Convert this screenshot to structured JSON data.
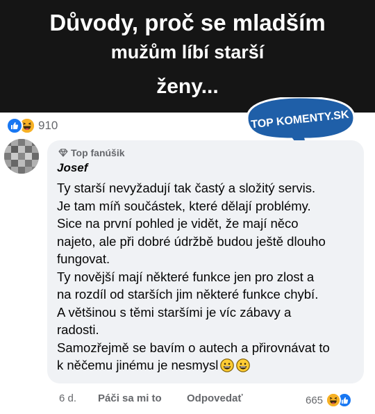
{
  "banner": {
    "line1": "Důvody, proč se mladším",
    "line2": "mužům líbí starší",
    "line3": "ženy..."
  },
  "post": {
    "reactions_count": "910",
    "reaction_icons": [
      "like-icon",
      "haha-icon"
    ]
  },
  "brand": {
    "label": "TOP KOMENTY.SK"
  },
  "comment": {
    "badge": "Top fanúšik",
    "author": "Josef",
    "lines": [
      "Ty starší nevyžadují tak častý a složitý servis.",
      "Je tam míň součástek, které dělají problémy.",
      "Sice na první pohled je vidět, že mají něco",
      "najeto, ale při dobré údržbě budou ještě dlouho",
      "fungovat.",
      "Ty novější mají některé funkce jen pro zlost a",
      "na rozdíl od starších jim některé funkce chybí.",
      "A většinou s těmi staršími je víc zábavy a",
      "radosti.",
      "Samozřejmě se bavím o autech a přirovnávat to",
      "k něčemu jinému je nesmysl"
    ],
    "age": "6 d.",
    "like_label": "Páči sa mi to",
    "reply_label": "Odpovedať",
    "reactions_count": "665"
  },
  "colors": {
    "banner_bg": "#151515",
    "brand_blue": "#1f5fa8",
    "bubble_bg": "#f0f2f5",
    "like_blue": "#1877f2",
    "haha_yellow": "#f7b125",
    "meta_gray": "#65676b"
  }
}
